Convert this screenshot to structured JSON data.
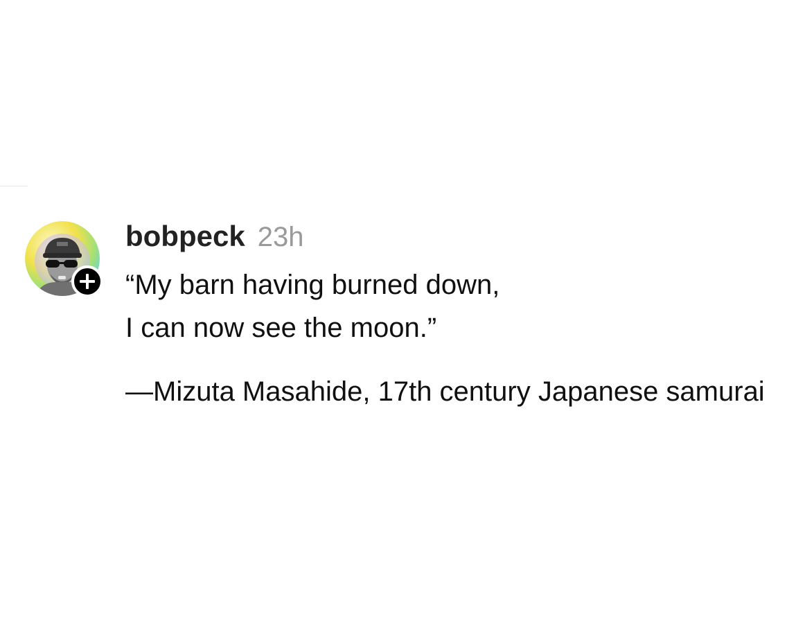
{
  "post": {
    "author": {
      "username": "bobpeck",
      "timestamp": "23h",
      "avatar_icon": "profile-photo",
      "follow_icon": "plus-icon"
    },
    "body": {
      "line1": "“My barn having burned down,",
      "line2": "I can now see the moon.”",
      "attribution": "—Mizuta Masahide, 17th century Japanese samurai"
    }
  },
  "colors": {
    "text": "#101010",
    "username": "#222222",
    "timestamp": "#9a9a9a",
    "badge": "#000000",
    "avatar_ring_start": "#f2e14a",
    "avatar_ring_end": "#59d0ea"
  }
}
